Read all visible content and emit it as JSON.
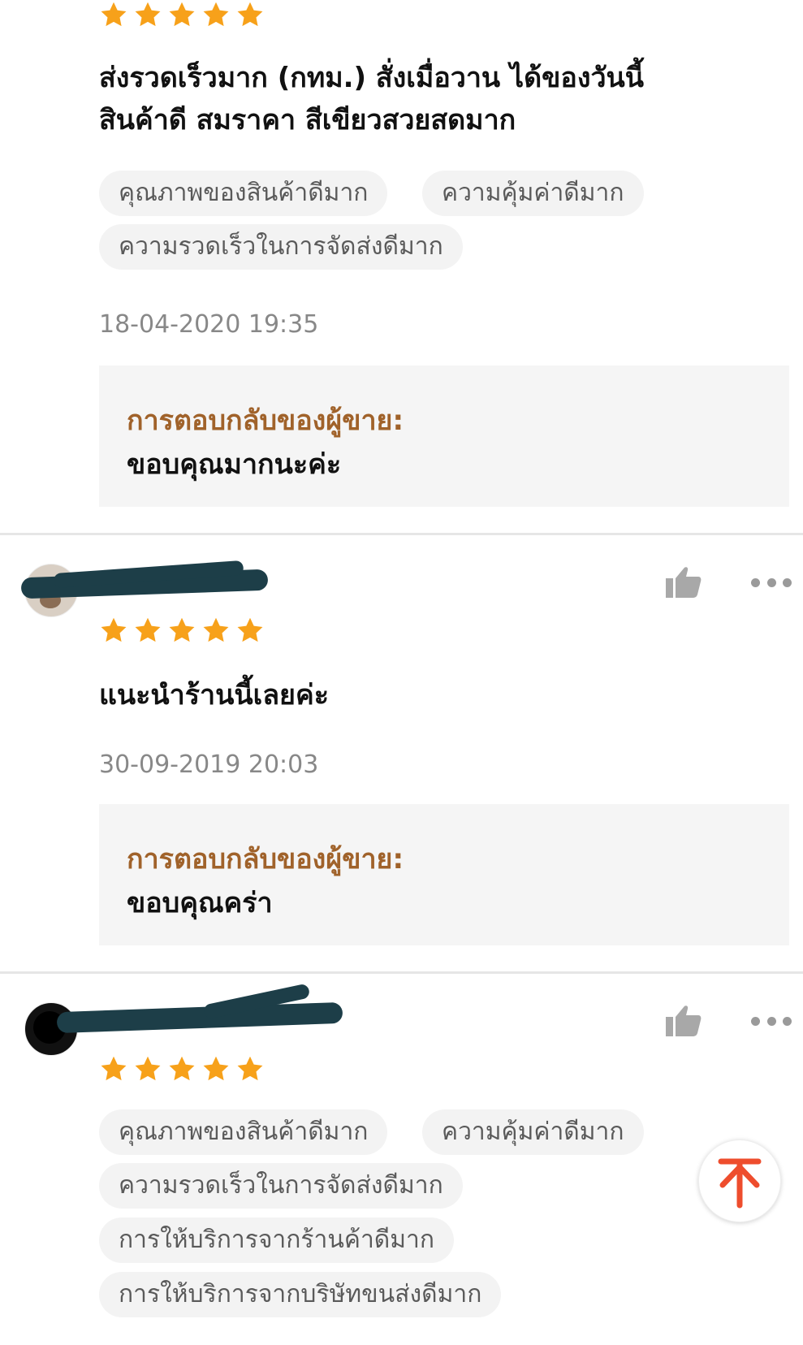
{
  "reviews": [
    {
      "rating": 5,
      "comment_lines": [
        "ส่งรวดเร็วมาก (กทม.) สั่งเมื่อวาน ได้ของวันนี้",
        "สินค้าดี สมราคา สีเขียวสวยสดมาก"
      ],
      "tags": [
        "คุณภาพของสินค้าดีมาก",
        "ความคุ้มค่าดีมาก",
        "ความรวดเร็วในการจัดส่งดีมาก"
      ],
      "timestamp": "18-04-2020 19:35",
      "seller_reply": {
        "label": "การตอบกลับของผู้ขาย:",
        "text": "ขอบคุณมากนะค่ะ"
      }
    },
    {
      "rating": 5,
      "comment_lines": [
        "แนะนำร้านนี้เลยค่ะ"
      ],
      "tags": [],
      "timestamp": "30-09-2019 20:03",
      "seller_reply": {
        "label": "การตอบกลับของผู้ขาย:",
        "text": "ขอบคุณคร่า"
      }
    },
    {
      "rating": 5,
      "comment_lines": [],
      "tags": [
        "คุณภาพของสินค้าดีมาก",
        "ความคุ้มค่าดีมาก",
        "ความรวดเร็วในการจัดส่งดีมาก",
        "การให้บริการจากร้านค้าดีมาก",
        "การให้บริการจากบริษัทขนส่งดีมาก"
      ]
    }
  ],
  "icons": {
    "like": "thumbs-up-icon",
    "more": "more-options-icon",
    "back_to_top": "arrow-up-icon",
    "star": "star-icon"
  },
  "colors": {
    "star": "#f7a11a",
    "seller_reply_label": "#a0622a",
    "back_to_top_arrow": "#ee4d2d",
    "redaction": "#1d3e48"
  }
}
